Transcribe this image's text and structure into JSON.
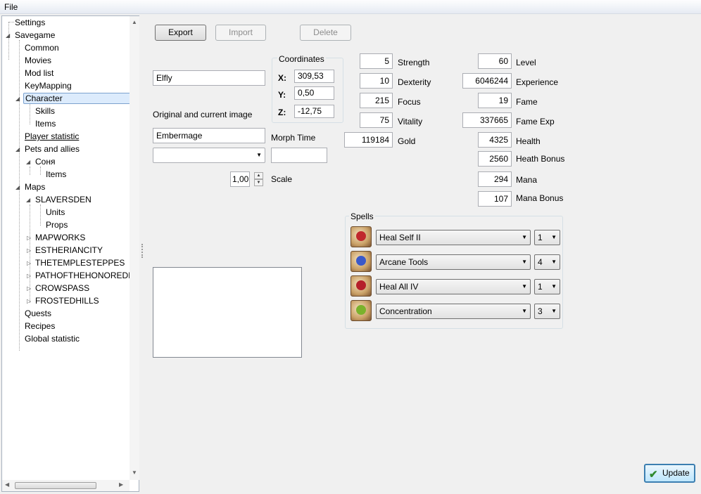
{
  "menu": {
    "file": "File"
  },
  "tree": {
    "settings": "Settings",
    "savegame": "Savegame",
    "common": "Common",
    "movies": "Movies",
    "modlist": "Mod list",
    "keymapping": "KeyMapping",
    "character": "Character",
    "skills": "Skills",
    "items": "Items",
    "player_statistic": "Player statistic",
    "pets": "Pets and allies",
    "sonya": "Соня",
    "sonya_items": "Items",
    "maps": "Maps",
    "slaversden": "SLAVERSDEN",
    "units": "Units",
    "props": "Props",
    "mapworks": "MAPWORKS",
    "estheriancity": "ESTHERIANCITY",
    "thetempleteppes": "THETEMPLESTEPPES",
    "pathofthehonored": "PATHOFTHEHONOREDD",
    "crowspass": "CROWSPASS",
    "frostedhills": "FROSTEDHILLS",
    "quests": "Quests",
    "recipes": "Recipes",
    "global_statistic": "Global statistic"
  },
  "toolbar": {
    "export": "Export",
    "import": "Import",
    "delete": "Delete"
  },
  "character": {
    "name": "Elfly",
    "image_label": "Original and current image",
    "image": "Embermage",
    "morph_label": "Morph Time",
    "morph_value": "",
    "scale_label": "Scale",
    "scale": "1,00"
  },
  "coords": {
    "title": "Coordinates",
    "x_label": "X:",
    "x": "309,53",
    "y_label": "Y:",
    "y": "0,50",
    "z_label": "Z:",
    "z": "-12,75"
  },
  "stats": {
    "strength": "5",
    "strength_label": "Strength",
    "dexterity": "10",
    "dexterity_label": "Dexterity",
    "focus": "215",
    "focus_label": "Focus",
    "vitality": "75",
    "vitality_label": "Vitality",
    "gold": "119184",
    "gold_label": "Gold",
    "level": "60",
    "level_label": "Level",
    "experience": "6046244",
    "experience_label": "Experience",
    "fame": "19",
    "fame_label": "Fame",
    "fame_exp": "337665",
    "fame_exp_label": "Fame Exp",
    "health": "4325",
    "health_label": "Health",
    "health_bonus": "2560",
    "health_bonus_label": "Heath Bonus",
    "mana": "294",
    "mana_label": "Mana",
    "mana_bonus": "107",
    "mana_bonus_label": "Mana Bonus"
  },
  "spells": {
    "title": "Spells",
    "list": [
      {
        "name": "Heal Self II",
        "level": "1",
        "color": "#c0282d"
      },
      {
        "name": "Arcane Tools",
        "level": "4",
        "color": "#3b59c9"
      },
      {
        "name": "Heal All IV",
        "level": "1",
        "color": "#b5202a"
      },
      {
        "name": "Concentration",
        "level": "3",
        "color": "#7ab22c"
      }
    ]
  },
  "update": "Update",
  "icons": {
    "check": "checkmark-icon"
  }
}
